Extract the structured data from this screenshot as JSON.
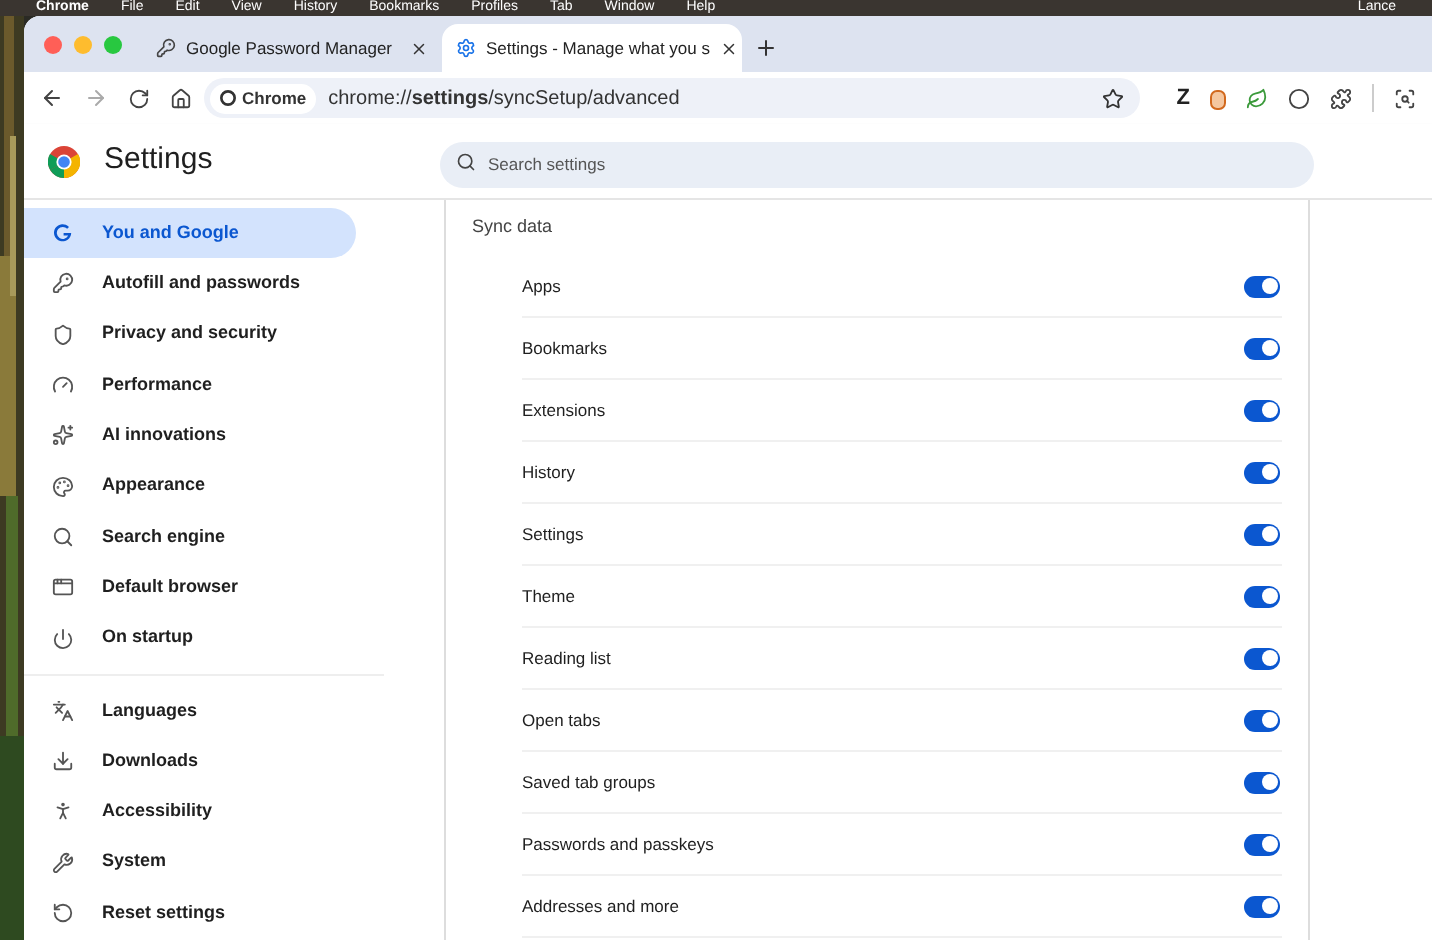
{
  "menu_bar": {
    "items": [
      "Chrome",
      "File",
      "Edit",
      "View",
      "History",
      "Bookmarks",
      "Profiles",
      "Tab",
      "Window",
      "Help"
    ],
    "user": "Lance"
  },
  "tabs": [
    {
      "title": "Google Password Manager",
      "selected": false
    },
    {
      "title": "Settings - Manage what you s",
      "selected": true
    }
  ],
  "toolbar": {
    "site_chip": "Chrome",
    "url_prefix": "chrome://",
    "url_bold": "settings",
    "url_rest": "/syncSetup/advanced",
    "extension_letter": "Z"
  },
  "header": {
    "title": "Settings",
    "search_placeholder": "Search settings"
  },
  "sidebar": {
    "groups": [
      [
        {
          "label": "You and Google",
          "selected": true
        },
        {
          "label": "Autofill and passwords",
          "selected": false
        },
        {
          "label": "Privacy and security",
          "selected": false
        },
        {
          "label": "Performance",
          "selected": false
        },
        {
          "label": "AI innovations",
          "selected": false
        },
        {
          "label": "Appearance",
          "selected": false
        },
        {
          "label": "Search engine",
          "selected": false
        },
        {
          "label": "Default browser",
          "selected": false
        },
        {
          "label": "On startup",
          "selected": false
        }
      ],
      [
        {
          "label": "Languages",
          "selected": false
        },
        {
          "label": "Downloads",
          "selected": false
        },
        {
          "label": "Accessibility",
          "selected": false
        },
        {
          "label": "System",
          "selected": false
        },
        {
          "label": "Reset settings",
          "selected": false
        }
      ]
    ]
  },
  "sync": {
    "title": "Sync data",
    "items": [
      {
        "label": "Apps",
        "on": true
      },
      {
        "label": "Bookmarks",
        "on": true
      },
      {
        "label": "Extensions",
        "on": true
      },
      {
        "label": "History",
        "on": true
      },
      {
        "label": "Settings",
        "on": true
      },
      {
        "label": "Theme",
        "on": true
      },
      {
        "label": "Reading list",
        "on": true
      },
      {
        "label": "Open tabs",
        "on": true
      },
      {
        "label": "Saved tab groups",
        "on": true
      },
      {
        "label": "Passwords and passkeys",
        "on": true
      },
      {
        "label": "Addresses and more",
        "on": true
      }
    ]
  }
}
